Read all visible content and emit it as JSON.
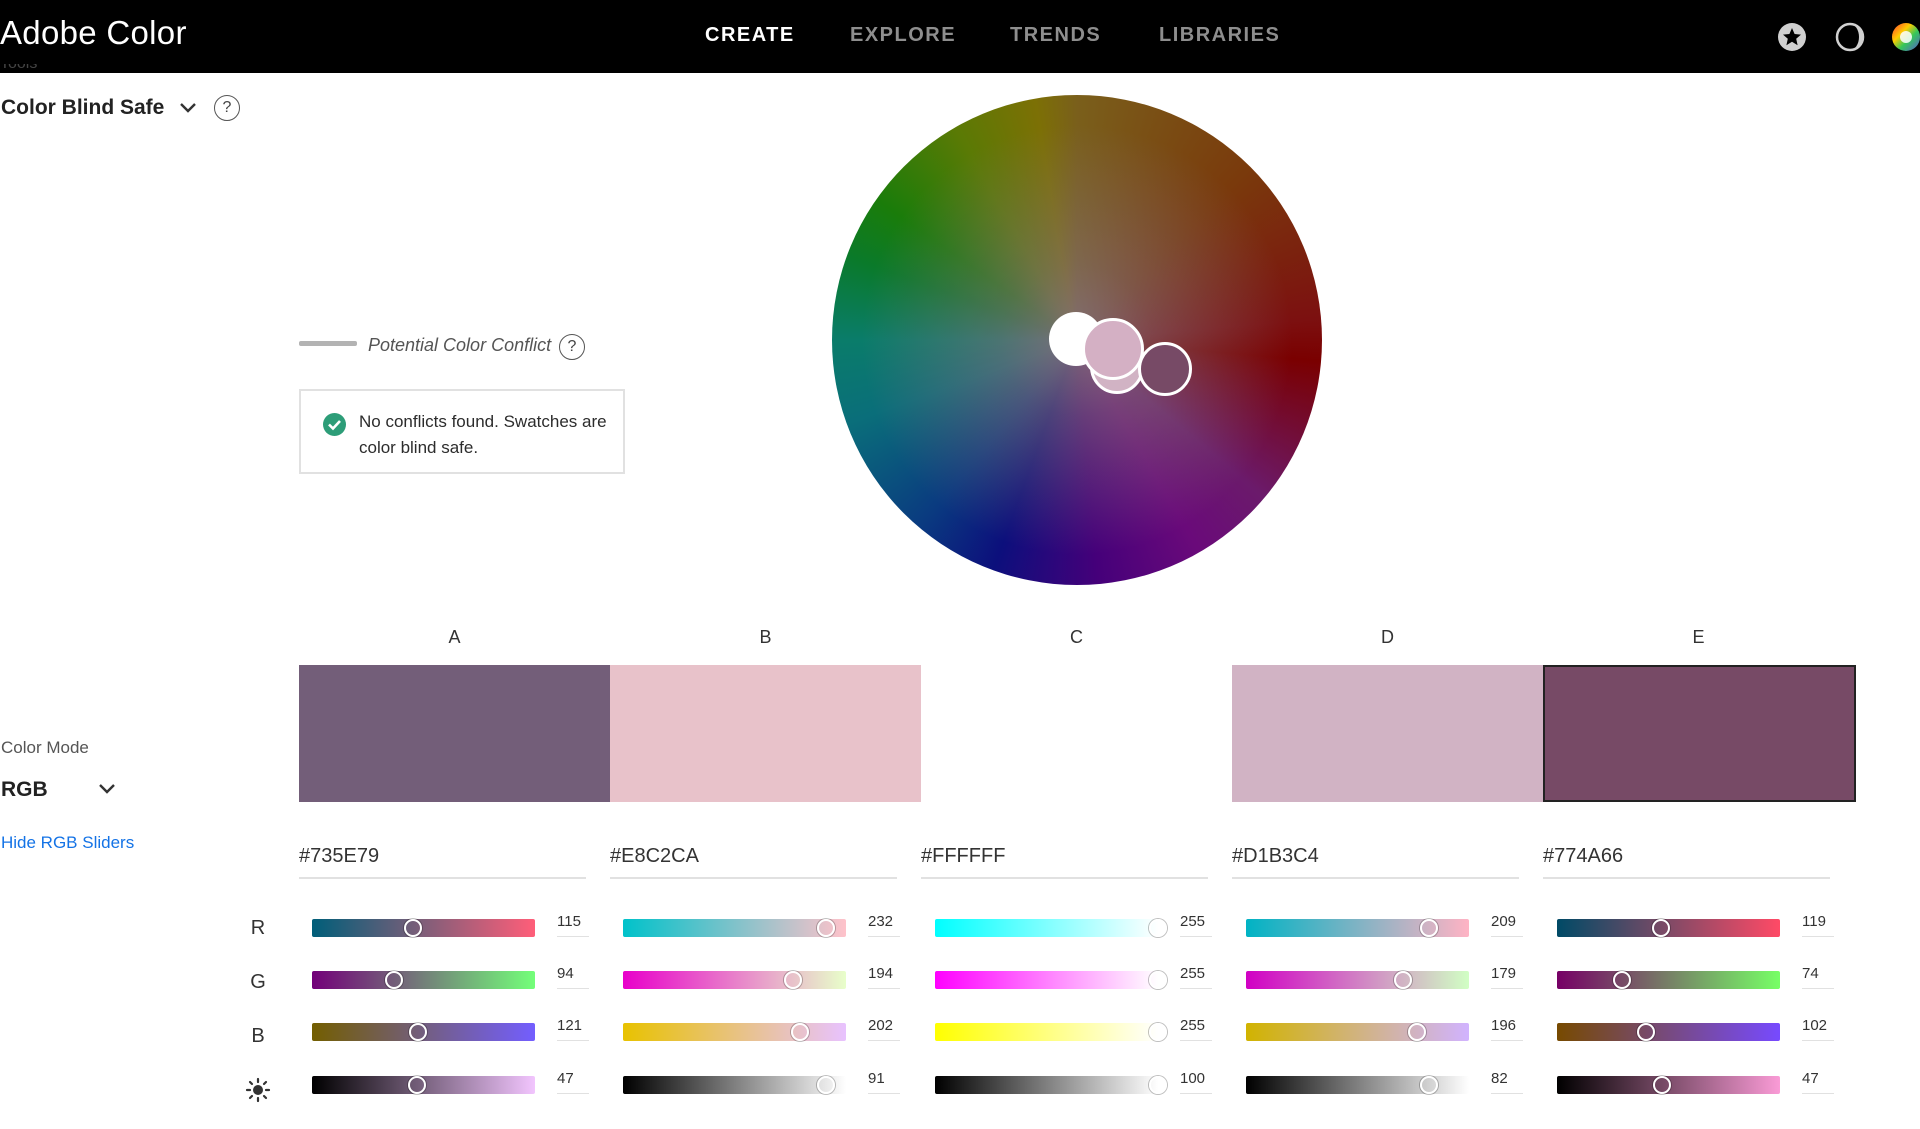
{
  "app": {
    "title": "Adobe Color"
  },
  "nav": {
    "items": [
      "CREATE",
      "EXPLORE",
      "TRENDS",
      "LIBRARIES"
    ],
    "active": "CREATE"
  },
  "top_icons": [
    "star-badge-icon",
    "contrast-moon-icon",
    "color-wheel-app-icon"
  ],
  "sidebar": {
    "tools_label": "Tools",
    "tool_selected": "Color Blind Safe",
    "color_mode_label": "Color Mode",
    "color_mode_value": "RGB",
    "hide_sliders_link": "Hide RGB Sliders"
  },
  "conflict": {
    "legend_label": "Potential Color Conflict",
    "message": "No conflicts found. Swatches are color blind safe."
  },
  "swatches": [
    {
      "label": "A",
      "hex": "#735E79",
      "r": 115,
      "g": 94,
      "b": 121,
      "brightness": 47
    },
    {
      "label": "B",
      "hex": "#E8C2CA",
      "r": 232,
      "g": 194,
      "b": 202,
      "brightness": 91
    },
    {
      "label": "C",
      "hex": "#FFFFFF",
      "r": 255,
      "g": 255,
      "b": 255,
      "brightness": 100
    },
    {
      "label": "D",
      "hex": "#D1B3C4",
      "r": 209,
      "g": 179,
      "b": 196,
      "brightness": 82
    },
    {
      "label": "E",
      "hex": "#774A66",
      "r": 119,
      "g": 74,
      "b": 102,
      "brightness": 47
    }
  ],
  "slider_rows": [
    "R",
    "G",
    "B",
    "brightness-icon"
  ],
  "colors": {
    "accent_link": "#1473e6",
    "success": "#2d9d78",
    "topbar": "#000000"
  }
}
